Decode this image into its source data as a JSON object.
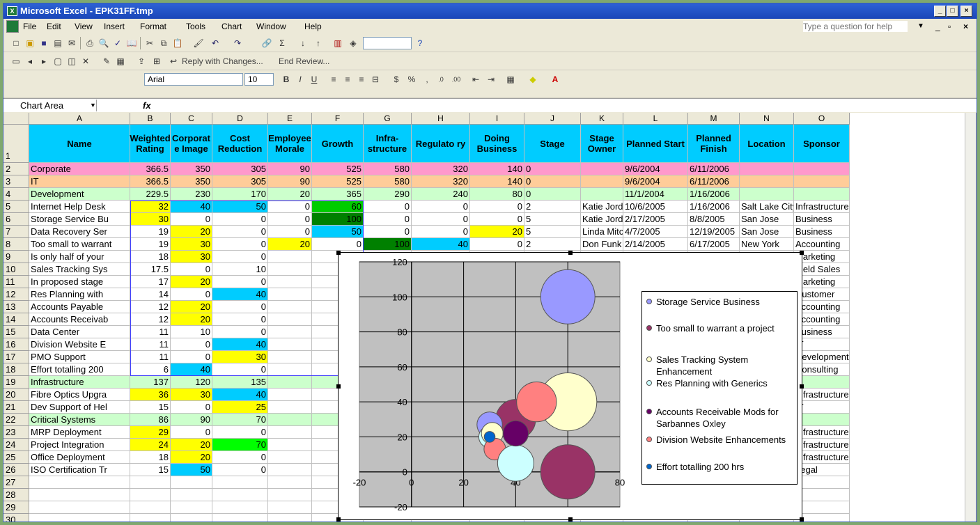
{
  "window": {
    "title": "Microsoft Excel - EPK31FF.tmp",
    "help_placeholder": "Type a question for help"
  },
  "menu": [
    "File",
    "Edit",
    "View",
    "Insert",
    "Format",
    "Tools",
    "Chart",
    "Window",
    "Help"
  ],
  "review": {
    "reply": "Reply with Changes...",
    "end": "End Review..."
  },
  "format": {
    "font": "Arial",
    "size": "10"
  },
  "namebox": "Chart Area",
  "fx": "fx",
  "columns": [
    "A",
    "B",
    "C",
    "D",
    "E",
    "F",
    "G",
    "H",
    "I",
    "J",
    "K",
    "L",
    "M",
    "N",
    "O"
  ],
  "headers": [
    "Name",
    "Weighted Rating",
    "Corporat e Image",
    "Cost Reduction",
    "Employee Morale",
    "Growth",
    "Infra- structure",
    "Regulato ry",
    "Doing Business",
    "Stage",
    "Stage Owner",
    "Planned Start",
    "Planned Finish",
    "Location",
    "Sponsor"
  ],
  "rows": [
    [
      "Corporate",
      "366.5",
      "350",
      "305",
      "90",
      "525",
      "580",
      "320",
      "140",
      "0",
      "",
      "9/6/2004",
      "6/11/2006",
      "",
      ""
    ],
    [
      "IT",
      "366.5",
      "350",
      "305",
      "90",
      "525",
      "580",
      "320",
      "140",
      "0",
      "",
      "9/6/2004",
      "6/11/2006",
      "",
      ""
    ],
    [
      "Development",
      "229.5",
      "230",
      "170",
      "20",
      "365",
      "290",
      "240",
      "80",
      "0",
      "",
      "11/1/2004",
      "1/16/2006",
      "",
      ""
    ],
    [
      "Internet Help Desk",
      "32",
      "40",
      "50",
      "0",
      "60",
      "0",
      "0",
      "0",
      "2",
      "Katie Jordan",
      "10/6/2005",
      "1/16/2006",
      "Salt Lake City",
      "Infrastructure"
    ],
    [
      "Storage Service Bu",
      "30",
      "0",
      "0",
      "0",
      "100",
      "0",
      "0",
      "0",
      "5",
      "Katie Jordan",
      "2/17/2005",
      "8/8/2005",
      "San Jose",
      "Business"
    ],
    [
      "Data Recovery Ser",
      "19",
      "20",
      "0",
      "0",
      "50",
      "0",
      "0",
      "20",
      "5",
      "Linda Mitc",
      "4/7/2005",
      "12/19/2005",
      "San Jose",
      "Business"
    ],
    [
      "Too small to warrant",
      "19",
      "30",
      "0",
      "20",
      "0",
      "100",
      "40",
      "0",
      "2",
      "Don Funk",
      "2/14/2005",
      "6/17/2005",
      "New York",
      "Accounting"
    ],
    [
      "Is only half of your",
      "18",
      "30",
      "0",
      "",
      "",
      "",
      "",
      "",
      "",
      "",
      "",
      "/25/2005",
      "San Jose",
      "Marketing"
    ],
    [
      "Sales Tracking Sys",
      "17.5",
      "0",
      "10",
      "",
      "",
      "",
      "",
      "",
      "",
      "",
      "",
      "/25/2005",
      "San Jose",
      "Field Sales"
    ],
    [
      "In proposed stage",
      "17",
      "20",
      "0",
      "",
      "",
      "",
      "",
      "",
      "",
      "",
      "",
      "/25/2005",
      "San Jose",
      "Marketing"
    ],
    [
      "Res Planning with",
      "14",
      "0",
      "40",
      "",
      "",
      "",
      "",
      "",
      "",
      "",
      "",
      "/12/2005",
      "San Jose",
      "Customer"
    ],
    [
      "Accounts Payable",
      "12",
      "20",
      "0",
      "",
      "",
      "",
      "",
      "",
      "",
      "",
      "",
      "/30/2005",
      "New York",
      "Accounting"
    ],
    [
      "Accounts Receivab",
      "12",
      "20",
      "0",
      "",
      "",
      "",
      "",
      "",
      "",
      "",
      "",
      "30/2005",
      "New York",
      "Accounting"
    ],
    [
      "Data Center",
      "11",
      "10",
      "0",
      "",
      "",
      "",
      "",
      "",
      "",
      "",
      "",
      "/2/2006",
      "San Jose",
      "Business"
    ],
    [
      "Division Website E",
      "11",
      "0",
      "40",
      "",
      "",
      "",
      "",
      "",
      "",
      "",
      "",
      "11/2005",
      "San Jose",
      "IT"
    ],
    [
      "PMO Support",
      "11",
      "0",
      "30",
      "",
      "",
      "",
      "",
      "",
      "",
      "",
      "",
      "/31/2005",
      "San Jose",
      "Development"
    ],
    [
      "Effort totalling 200",
      "6",
      "40",
      "0",
      "",
      "",
      "",
      "",
      "",
      "",
      "",
      "",
      "28/2005",
      "San Jose",
      "Consulting"
    ],
    [
      "Infrastructure",
      "137",
      "120",
      "135",
      "",
      "",
      "",
      "",
      "",
      "",
      "",
      "",
      "11/2006",
      "",
      ""
    ],
    [
      "Fibre Optics Upgra",
      "36",
      "30",
      "40",
      "",
      "",
      "",
      "",
      "",
      "",
      "",
      "",
      "/17/2005",
      "California",
      "Infrastructure"
    ],
    [
      "Dev Support of Hel",
      "15",
      "0",
      "25",
      "",
      "",
      "",
      "",
      "",
      "",
      "",
      "",
      "/31/2005",
      "San Jose",
      "IT"
    ],
    [
      "Critical Systems",
      "86",
      "90",
      "70",
      "",
      "",
      "",
      "",
      "",
      "",
      "",
      "",
      "11/2006",
      "",
      ""
    ],
    [
      "MRP Deployment",
      "29",
      "0",
      "0",
      "",
      "",
      "",
      "",
      "",
      "",
      "",
      "",
      "/25/2005",
      "Salt Lake City",
      "Infrastructure"
    ],
    [
      "Project Integration",
      "24",
      "20",
      "70",
      "",
      "",
      "",
      "",
      "",
      "",
      "",
      "",
      "/27/2005",
      "Salt Lake City",
      "Infrastructure"
    ],
    [
      "Office Deployment",
      "18",
      "20",
      "0",
      "",
      "",
      "",
      "",
      "",
      "",
      "",
      "",
      "11/2006",
      "Salt Lake City",
      "Infrastructure"
    ],
    [
      "ISO Certification Tr",
      "15",
      "50",
      "0",
      "",
      "",
      "",
      "",
      "",
      "",
      "",
      "",
      "0/7/2005",
      "Germany",
      "Legal"
    ]
  ],
  "rowfills": {
    "2": "#ff99cc",
    "3": "#ffcc99",
    "4": "#ccffcc",
    "19": "#ccffcc",
    "22": "#ccffcc"
  },
  "chart_data": {
    "type": "bubble",
    "xlim": [
      -20,
      80
    ],
    "ylim": [
      -20,
      120
    ],
    "xticks": [
      "-20",
      "0",
      "20",
      "40",
      "60",
      "80"
    ],
    "yticks": [
      "-20",
      "0",
      "20",
      "40",
      "60",
      "80",
      "100",
      "120"
    ],
    "series": [
      {
        "name": "Storage Service Business",
        "color": "#9999ff",
        "x": 60,
        "y": 100,
        "size": 30
      },
      {
        "name": "Too small to warrant a project",
        "color": "#993366",
        "x": 60,
        "y": 0,
        "size": 30
      },
      {
        "name": "Sales Tracking System Enhancement",
        "color": "#ffffcc",
        "x": 60,
        "y": 40,
        "size": 32
      },
      {
        "name": "Res Planning with Generics",
        "color": "#ccffff",
        "x": 40,
        "y": 5,
        "size": 20
      },
      {
        "name": "Accounts Receivable Mods for Sarbannes Oxley",
        "color": "#660066",
        "x": 40,
        "y": 22,
        "size": 14
      },
      {
        "name": "Division Website Enhancements",
        "color": "#ff8080",
        "x": 48,
        "y": 40,
        "size": 22
      },
      {
        "name": "Effort totalling 200 hrs",
        "color": "#0066cc",
        "x": 30,
        "y": 20,
        "size": 6
      }
    ],
    "extra_bubbles": [
      {
        "color": "#993366",
        "x": 40,
        "y": 30,
        "size": 22
      },
      {
        "color": "#9999ff",
        "x": 30,
        "y": 27,
        "size": 14
      },
      {
        "color": "#ccffff",
        "x": 30,
        "y": 20,
        "size": 12
      },
      {
        "color": "#ffffcc",
        "x": 31,
        "y": 22,
        "size": 12
      },
      {
        "color": "#ff8080",
        "x": 32,
        "y": 13,
        "size": 12
      }
    ]
  }
}
